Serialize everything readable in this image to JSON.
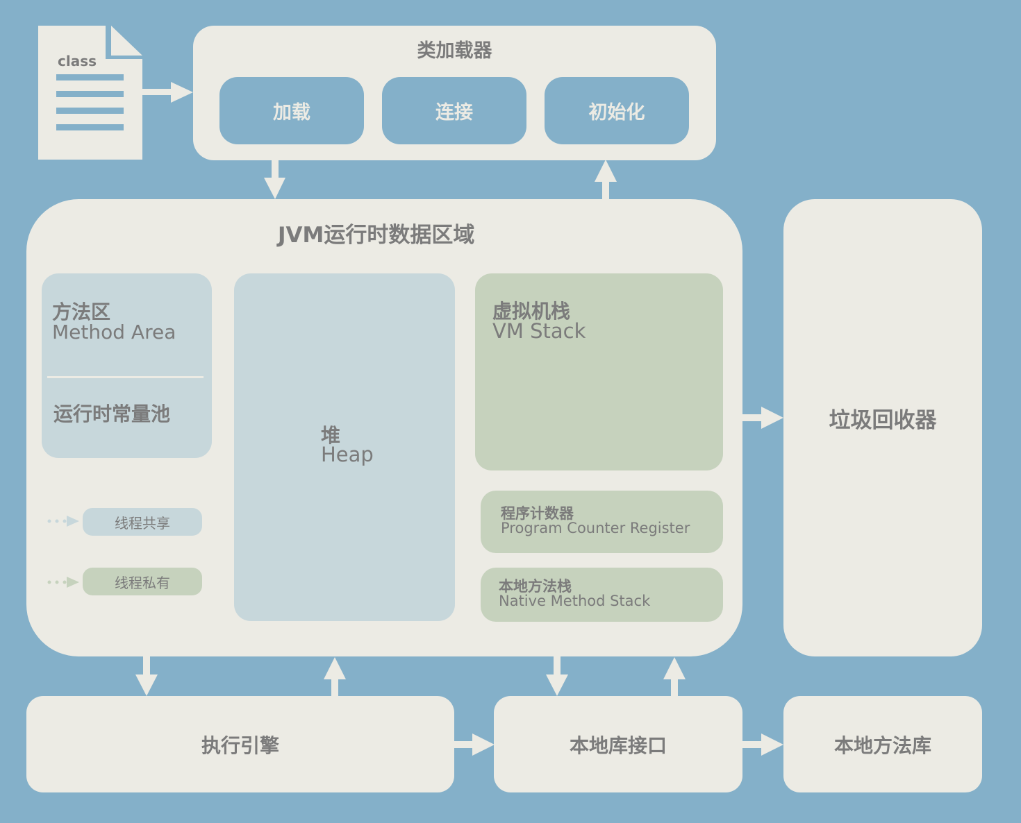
{
  "class_file": {
    "label": "class"
  },
  "class_loader": {
    "title": "类加载器",
    "stages": [
      "加载",
      "连接",
      "初始化"
    ]
  },
  "runtime_area": {
    "title": "JVM运行时数据区域",
    "method_area": {
      "title_cn": "方法区",
      "title_en": "Method Area",
      "sub": "运行时常量池"
    },
    "heap": {
      "title_cn": "堆",
      "title_en": "Heap"
    },
    "vm_stack": {
      "title_cn": "虚拟机栈",
      "title_en": "VM Stack"
    },
    "pc_register": {
      "title_cn": "程序计数器",
      "title_en": "Program Counter Register"
    },
    "native_stack": {
      "title_cn": "本地方法栈",
      "title_en": "Native Method Stack"
    },
    "legend": {
      "shared": "线程共享",
      "private": "线程私有"
    }
  },
  "garbage_collector": {
    "title": "垃圾回收器"
  },
  "execution_engine": {
    "title": "执行引擎"
  },
  "native_interface": {
    "title": "本地库接口"
  },
  "native_library": {
    "title": "本地方法库"
  },
  "colors": {
    "background": "#84b0c9",
    "panel": "#ecebe4",
    "shared": "#c7d7db",
    "private": "#c6d2bd",
    "text": "#7b7b7b"
  }
}
